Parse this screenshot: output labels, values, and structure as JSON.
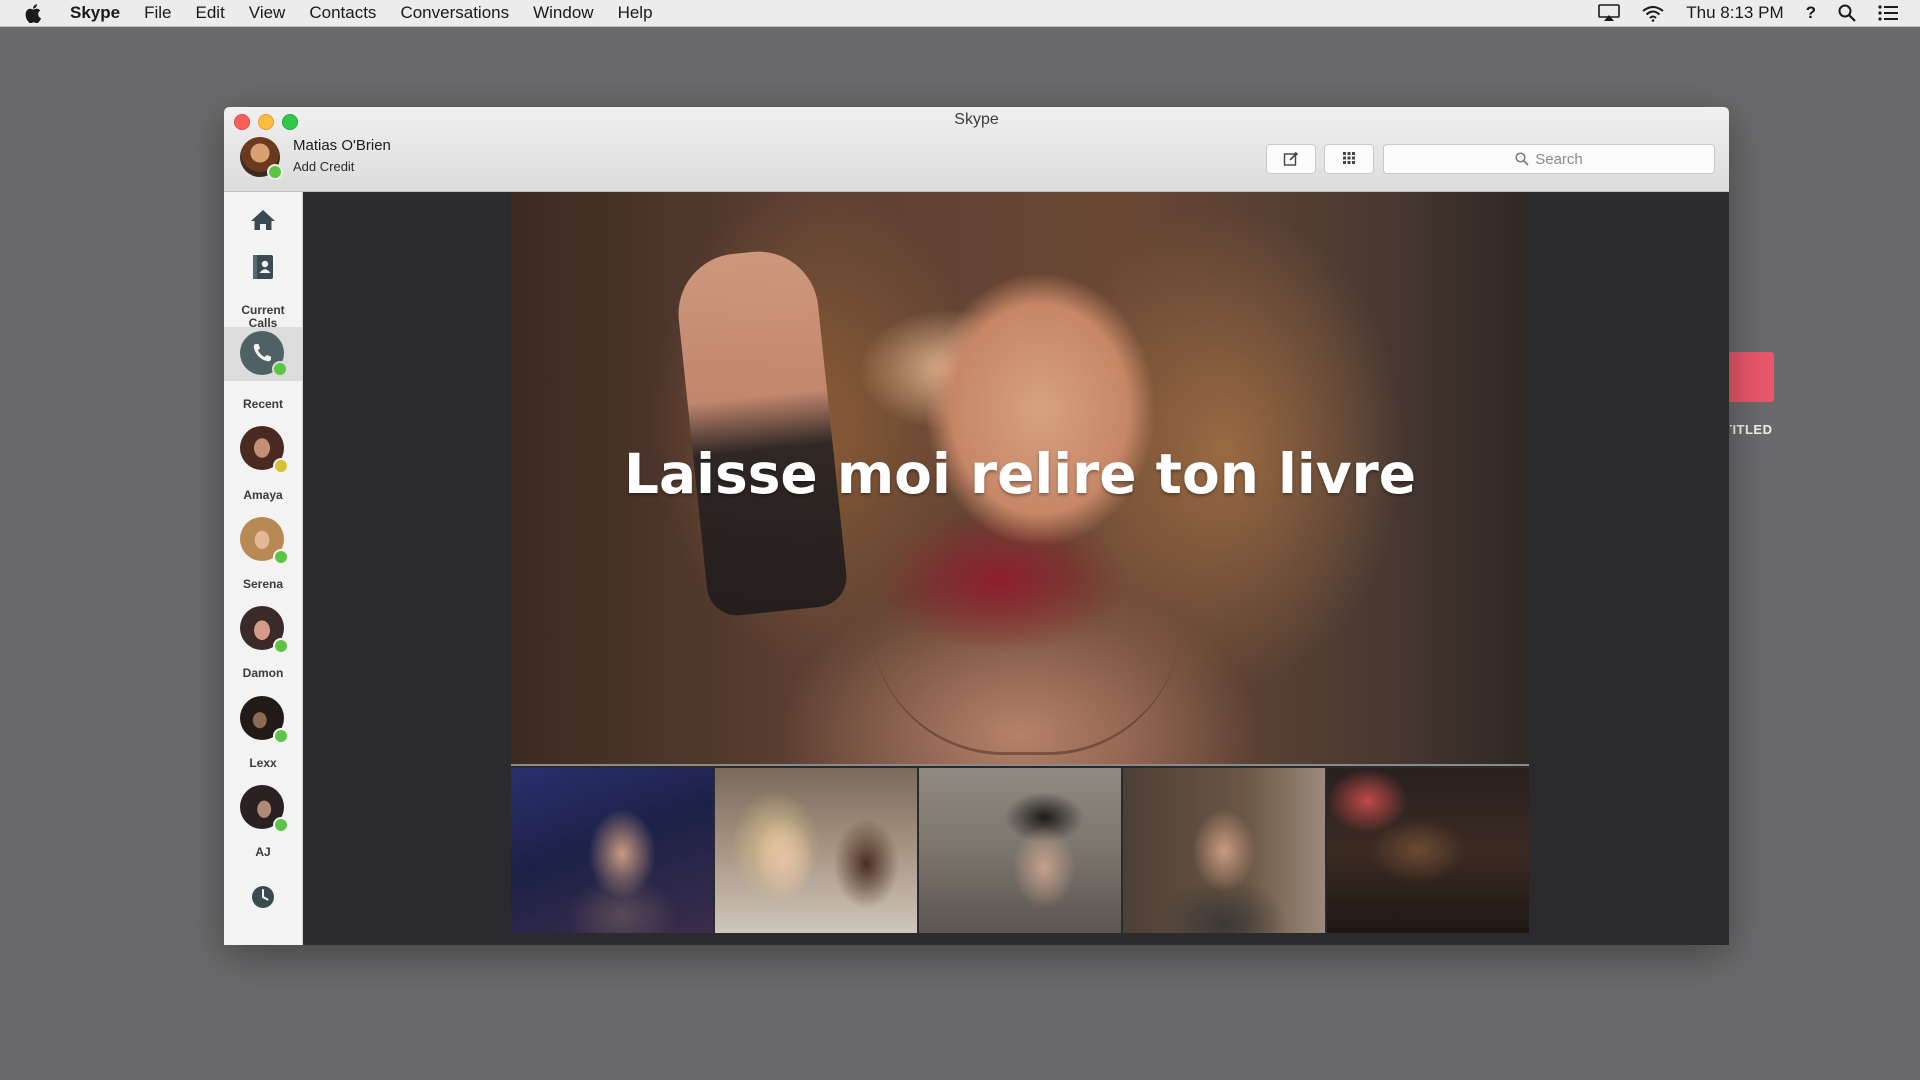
{
  "menubar": {
    "app_name": "Skype",
    "items": [
      "File",
      "Edit",
      "View",
      "Contacts",
      "Conversations",
      "Window",
      "Help"
    ],
    "clock": "Thu 8:13 PM",
    "help_glyph": "?"
  },
  "desktop": {
    "label": "TITLED"
  },
  "window": {
    "title": "Skype",
    "profile": {
      "name": "Matias O'Brien",
      "add_credit": "Add Credit"
    },
    "search": {
      "placeholder": "Search"
    }
  },
  "sidebar": {
    "current_calls_label": "Current Calls",
    "recent_label": "Recent",
    "contacts": [
      {
        "name": "Amaya",
        "status": "away"
      },
      {
        "name": "Serena",
        "status": "online"
      },
      {
        "name": "Damon",
        "status": "online"
      },
      {
        "name": "Lexx",
        "status": "online"
      },
      {
        "name": "AJ",
        "status": "online"
      }
    ]
  },
  "call": {
    "subtitle": "Laisse moi relire ton livre",
    "participant_thumbnails": 5
  },
  "colors": {
    "online": "#5cc545",
    "away": "#d6c132",
    "close": "#fc605b",
    "minimize": "#fdbc40",
    "maximize": "#34c84a"
  }
}
